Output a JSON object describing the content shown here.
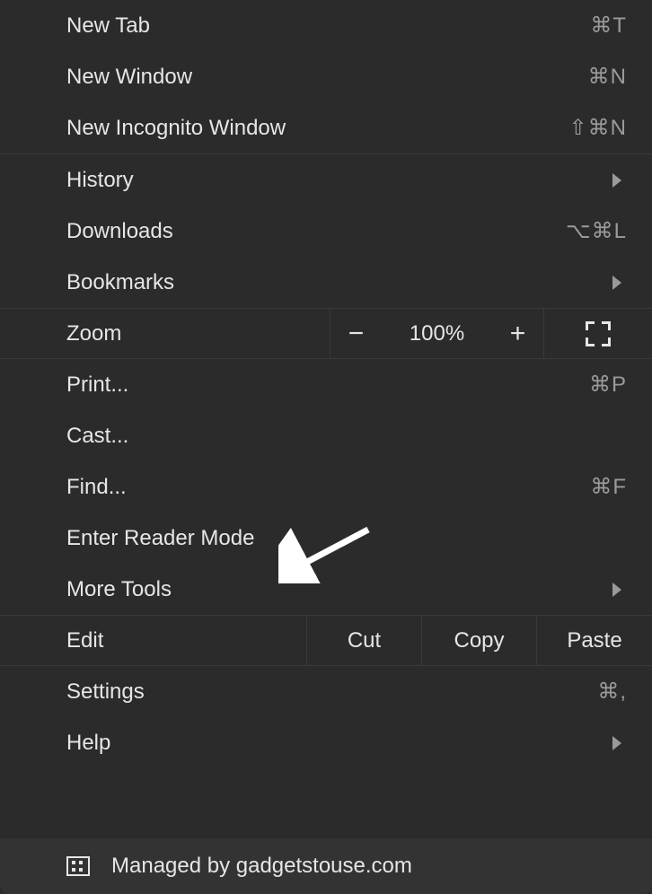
{
  "menu": {
    "new_tab": {
      "label": "New Tab",
      "shortcut": "⌘T"
    },
    "new_window": {
      "label": "New Window",
      "shortcut": "⌘N"
    },
    "new_incognito": {
      "label": "New Incognito Window",
      "shortcut": "⇧⌘N"
    },
    "history": {
      "label": "History"
    },
    "downloads": {
      "label": "Downloads",
      "shortcut": "⌥⌘L"
    },
    "bookmarks": {
      "label": "Bookmarks"
    },
    "zoom": {
      "label": "Zoom",
      "value": "100%"
    },
    "print": {
      "label": "Print...",
      "shortcut": "⌘P"
    },
    "cast": {
      "label": "Cast..."
    },
    "find": {
      "label": "Find...",
      "shortcut": "⌘F"
    },
    "reader": {
      "label": "Enter Reader Mode"
    },
    "more_tools": {
      "label": "More Tools"
    },
    "edit": {
      "label": "Edit",
      "cut": "Cut",
      "copy": "Copy",
      "paste": "Paste"
    },
    "settings": {
      "label": "Settings",
      "shortcut": "⌘,"
    },
    "help": {
      "label": "Help"
    }
  },
  "footer": {
    "text": "Managed by gadgetstouse.com"
  }
}
